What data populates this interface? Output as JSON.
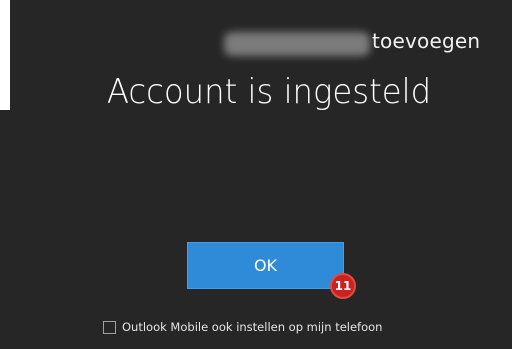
{
  "dialog": {
    "add_label": "toevoegen",
    "title": "Account is ingesteld",
    "ok_label": "OK",
    "step_badge": "11",
    "checkbox_label": "Outlook Mobile ook instellen op mijn telefoon",
    "checkbox_checked": false
  },
  "colors": {
    "background": "#262626",
    "ok_button": "#2f8bd8",
    "badge": "#c9221f"
  }
}
